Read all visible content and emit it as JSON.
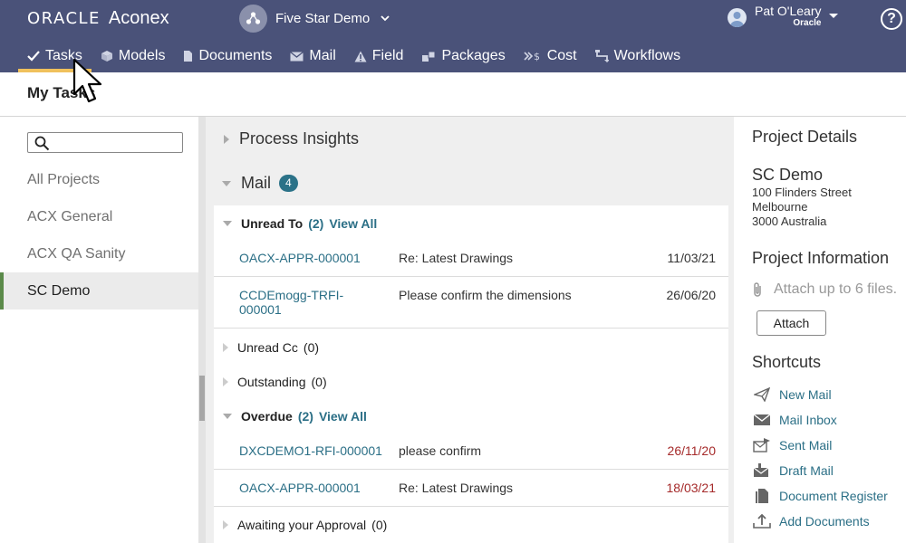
{
  "header": {
    "brand_oracle": "ORACLE",
    "brand_product": "Aconex",
    "project_name": "Five Star Demo",
    "user_name": "Pat O'Leary",
    "user_org": "Oracle",
    "help_label": "?"
  },
  "nav": [
    {
      "label": "Tasks",
      "icon": "check-icon",
      "active": true
    },
    {
      "label": "Models",
      "icon": "cube-icon"
    },
    {
      "label": "Documents",
      "icon": "document-icon"
    },
    {
      "label": "Mail",
      "icon": "envelope-icon"
    },
    {
      "label": "Field",
      "icon": "warning-icon"
    },
    {
      "label": "Packages",
      "icon": "packages-icon"
    },
    {
      "label": "Cost",
      "icon": "cost-icon"
    },
    {
      "label": "Workflows",
      "icon": "workflow-icon"
    }
  ],
  "page": {
    "title": "My Tasks"
  },
  "sidebar": {
    "search_placeholder": "",
    "items": [
      {
        "label": "All Projects"
      },
      {
        "label": "ACX General"
      },
      {
        "label": "ACX QA Sanity"
      },
      {
        "label": "SC Demo",
        "active": true
      }
    ]
  },
  "main": {
    "process_insights": "Process Insights",
    "mail_title": "Mail",
    "mail_count": "4",
    "unread_to": {
      "label": "Unread To",
      "count": "(2)",
      "view_all": "View All"
    },
    "unread_to_rows": [
      {
        "number": "OACX-APPR-000001",
        "subject": "Re: Latest Drawings",
        "date": "11/03/21"
      },
      {
        "number": "CCDEmogg-TRFI-000001",
        "subject": "Please confirm the dimensions",
        "date": "26/06/20"
      }
    ],
    "unread_cc": {
      "label": "Unread Cc",
      "count": "(0)"
    },
    "outstanding": {
      "label": "Outstanding",
      "count": "(0)"
    },
    "overdue": {
      "label": "Overdue",
      "count": "(2)",
      "view_all": "View All"
    },
    "overdue_rows": [
      {
        "number": "DXCDEMO1-RFI-000001",
        "subject": "please confirm",
        "date": "26/11/20"
      },
      {
        "number": "OACX-APPR-000001",
        "subject": "Re: Latest Drawings",
        "date": "18/03/21"
      }
    ],
    "awaiting": {
      "label": "Awaiting your Approval",
      "count": "(0)"
    }
  },
  "right": {
    "project_details_title": "Project Details",
    "project_name": "SC Demo",
    "address_line1": "100 Flinders Street",
    "address_line2": "Melbourne",
    "address_line3": "3000 Australia",
    "project_info_title": "Project Information",
    "attach_placeholder": "Attach up to 6 files.",
    "attach_button": "Attach",
    "shortcuts_title": "Shortcuts",
    "shortcuts": [
      {
        "label": "New Mail",
        "icon": "send-icon"
      },
      {
        "label": "Mail Inbox",
        "icon": "inbox-icon"
      },
      {
        "label": "Sent Mail",
        "icon": "sent-mail-icon"
      },
      {
        "label": "Draft Mail",
        "icon": "draft-mail-icon"
      },
      {
        "label": "Document Register",
        "icon": "document-register-icon"
      },
      {
        "label": "Add Documents",
        "icon": "upload-icon"
      }
    ]
  },
  "colors": {
    "header_bg": "#4a5279",
    "active_tab_underline": "#f0c15c",
    "link": "#2b6f86",
    "badge": "#2b7288",
    "overdue_date": "#a52a2a",
    "sidebar_active_marker": "#5b8a4a"
  }
}
